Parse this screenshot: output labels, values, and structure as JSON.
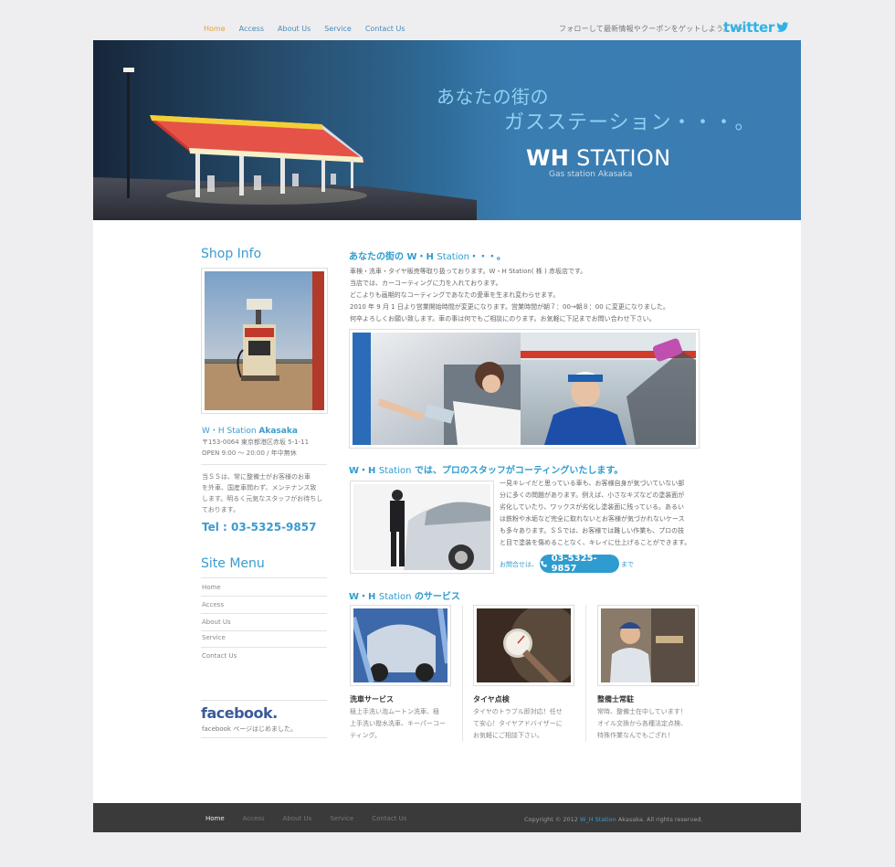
{
  "topnav": {
    "items": [
      "Home",
      "Access",
      "About Us",
      "Service",
      "Contact Us"
    ]
  },
  "follow_text": "フォローして最新情報やクーポンをゲットしよう。>>",
  "twitter_label": "twitter",
  "hero": {
    "tagline1": "あなたの街の",
    "tagline2": "ガスステーション・・・。",
    "brand_bold": "WH",
    "brand_rest": " STATION",
    "subtitle": "Gas station Akasaka"
  },
  "sidebar": {
    "shop_info_title": "Shop Info",
    "shop_name_prefix": "W・H Station ",
    "shop_name_bold": "Akasaka",
    "address": "〒153-0064 東京都港区赤坂 5-1-11",
    "hours": "OPEN 9:00 〜 20:00 / 年中無休",
    "desc": [
      "当ＳＳは、常に整備士がお客様のお車",
      "を外車、国産車問わず、メンテナンス致",
      "します。明るく元気なスタッフがお待ちし",
      "ております。"
    ],
    "tel": "Tel : 03-5325-9857",
    "site_menu_title": "Site Menu",
    "menu": [
      "Home",
      "Access",
      "About Us",
      "Service",
      "Contact Us"
    ],
    "facebook_logo": "facebook.",
    "facebook_text": "facebook ページはじめました。"
  },
  "intro": {
    "heading_a": "あなたの街の W・H ",
    "heading_b": "Station",
    "heading_c": "・・・。",
    "lines": [
      "車検・洗車・タイヤ販売等取り扱っております。W・H Station( 株 ) 赤坂店です。",
      "当店では、カーコーティングに力を入れております。",
      "どこよりも画期的なコーティングであなたの愛車を生まれ変わらせます。",
      "2010 年 9 月 1 日より営業開始時間が変更になります。営業時間が朝７：00→朝８：00 に変更になりました。",
      "何卒よろしくお願い致します。車の事は何でもご相談にのります。お気軽に下記までお問い合わせ下さい。"
    ]
  },
  "coating": {
    "heading_a": "W・H ",
    "heading_b": "Station",
    "heading_c": " では、プロのスタッフがコーティングいたします。",
    "lines": [
      "一見キレイだと思っている車も、お客様自身が気づいていない部",
      "分に多くの問題があります。例えば、小さなキズなどの塗装面が",
      "劣化していたり、ワックスが劣化し塗装面に残っている。あるい",
      "は鉄粉や水垢など完全に取れないとお客様が気づかれないケース",
      "も多々あります。ＳＳでは、お客様では難しい作業も、プロの技",
      "と目で塗装を傷めることなく、キレイに仕上げることができます。"
    ],
    "contact_prefix": "お問合せは、",
    "contact_number": "03-5325-9857",
    "contact_suffix": "まで"
  },
  "services": {
    "heading_a": "W・H ",
    "heading_b": "Station",
    "heading_c": " のサービス",
    "items": [
      {
        "title": "洗車サービス",
        "lines": [
          "極上手洗い泡ムートン洗車、極",
          "上手洗い撥水洗車、キーパーコー",
          "ティング。"
        ]
      },
      {
        "title": "タイヤ点検",
        "lines": [
          "タイヤのトラブル即対応！任せ",
          "て安心！タイヤアドバイザーに",
          "お気軽にご相談下さい。"
        ]
      },
      {
        "title": "整備士常駐",
        "lines": [
          "常時、整備士在中しています！",
          "オイル交換から各種法定点検、",
          "特殊作業なんでもござれ！"
        ]
      }
    ]
  },
  "footer": {
    "nav": [
      "Home",
      "Access",
      "About Us",
      "Service",
      "Contact Us"
    ],
    "copyright_a": "Copyright © 2012 ",
    "copyright_b": "W_H Station",
    "copyright_c": " Akasaka. All rights reserved."
  }
}
